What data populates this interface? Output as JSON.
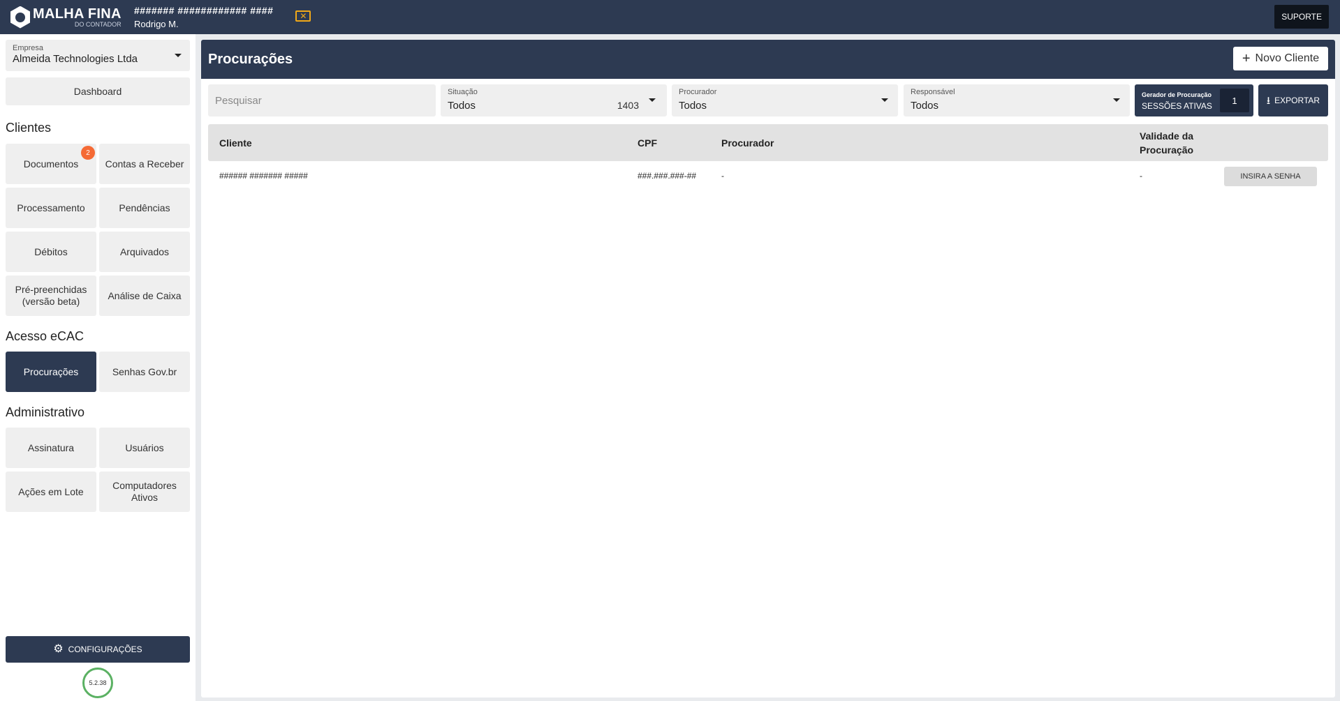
{
  "topbar": {
    "logo_main": "MALHA FINA",
    "logo_sub": "DO CONTADOR",
    "user_masked": "####### ############ ####",
    "user_name": "Rodrigo M.",
    "warn_glyph": "✕",
    "support_label": "SUPORTE"
  },
  "sidebar": {
    "empresa_label": "Empresa",
    "empresa_value": "Almeida Technologies Ltda",
    "dashboard_label": "Dashboard",
    "clientes_title": "Clientes",
    "documentos_label": "Documentos",
    "documentos_badge": "2",
    "contas_receber_label": "Contas a Receber",
    "processamento_label": "Processamento",
    "pendencias_label": "Pendências",
    "debitos_label": "Débitos",
    "arquivados_label": "Arquivados",
    "pre_preenchidas_label": "Pré-preenchidas (versão beta)",
    "analise_caixa_label": "Análise de Caixa",
    "acesso_title": "Acesso eCAC",
    "procuracoes_label": "Procurações",
    "senhas_label": "Senhas Gov.br",
    "admin_title": "Administrativo",
    "assinatura_label": "Assinatura",
    "usuarios_label": "Usuários",
    "acoes_lote_label": "Ações em Lote",
    "computadores_label": "Computadores Ativos",
    "config_label": "CONFIGURAÇÕES",
    "version": "5.2.38"
  },
  "main": {
    "title": "Procurações",
    "new_client_label": "Novo Cliente",
    "search_placeholder": "Pesquisar",
    "situacao_label": "Situação",
    "situacao_value": "Todos",
    "situacao_count": "1403",
    "procurador_label": "Procurador",
    "procurador_value": "Todos",
    "responsavel_label": "Responsável",
    "responsavel_value": "Todos",
    "gerador_title": "Gerador de Procuração",
    "gerador_sub": "SESSÕES ATIVAS",
    "gerador_count": "1",
    "export_label": "EXPORTAR"
  },
  "table": {
    "headers": {
      "cliente": "Cliente",
      "cpf": "CPF",
      "procurador": "Procurador",
      "validade": "Validade da Procuração"
    },
    "rows": [
      {
        "cliente": "###### ####### #####",
        "cpf": "###.###.###-##",
        "procurador": "-",
        "validade": "-",
        "action": "INSIRA A SENHA"
      }
    ]
  }
}
